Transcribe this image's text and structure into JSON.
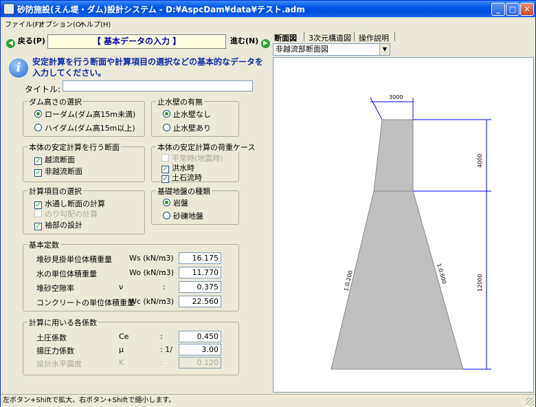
{
  "window": {
    "title": "砂防施設(えん堤・ダム)設計システム - D:¥AspcDam¥data¥テスト.adm",
    "controls": {
      "minimize": "_",
      "maximize": "□",
      "close": "✕"
    }
  },
  "menu": [
    "ファイル(F)",
    "オプション(O)",
    "ヘルプ(H)"
  ],
  "nav": {
    "back": "戻る(P)",
    "next": "進む(N)",
    "heading": "【 基本データの入力 】"
  },
  "info": "安定計算を行う断面や計算項目の選択などの基本的なデータを入力してください。",
  "title_field": {
    "label": "タイトル:",
    "value": ""
  },
  "dam_height": {
    "legend": "ダム高さの選択",
    "options": [
      "ローダム(ダム高15m未満)",
      "ハイダム(ダム高15m以上)"
    ],
    "selected": "ローダム(ダム高15m未満)"
  },
  "cutoff_wall": {
    "legend": "止水壁の有無",
    "options": [
      "止水壁なし",
      "止水壁あり"
    ],
    "selected": "止水壁なし"
  },
  "sections": {
    "legend": "本体の安定計算を行う断面",
    "items": [
      {
        "label": "越流断面",
        "checked": true
      },
      {
        "label": "非越流断面",
        "checked": true
      }
    ]
  },
  "load_cases": {
    "legend": "本体の安定計算の荷重ケース",
    "items": [
      {
        "label": "平常時(地震時)",
        "checked": false,
        "disabled": true
      },
      {
        "label": "洪水時",
        "checked": true,
        "disabled": false
      },
      {
        "label": "土石流時",
        "checked": true,
        "disabled": false
      }
    ]
  },
  "calc_items": {
    "legend": "計算項目の選択",
    "items": [
      {
        "label": "水通し断面の計算",
        "checked": true,
        "disabled": false
      },
      {
        "label": "のり勾配の計算",
        "checked": false,
        "disabled": true
      },
      {
        "label": "袖部の設計",
        "checked": true,
        "disabled": false
      }
    ]
  },
  "foundation": {
    "legend": "基礎地盤の種類",
    "options": [
      "岩盤",
      "砂礫地盤"
    ],
    "selected": "岩盤"
  },
  "constants": {
    "legend": "基本定数",
    "rows": [
      {
        "label": "堆砂見掛単位体積重量",
        "symbol": "Ws (kN/m3)",
        "colon": ":",
        "value": "16.175"
      },
      {
        "label": "水の単位体積重量",
        "symbol": "Wo (kN/m3)",
        "colon": ":",
        "value": "11.770"
      },
      {
        "label": "堆砂空隙率",
        "symbol": "ν",
        "colon": ":",
        "value": "0.375"
      },
      {
        "label": "コンクリートの単位体積重量",
        "symbol": "Wc (kN/m3)",
        "colon": ":",
        "value": "22.560"
      }
    ]
  },
  "coefficients": {
    "legend": "計算に用いる各係数",
    "rows": [
      {
        "label": "土圧係数",
        "symbol": "Ce",
        "colon": ":",
        "value": "0.450",
        "disabled": false
      },
      {
        "label": "揚圧力係数",
        "symbol": "μ",
        "colon": ": 1/",
        "value": "3.00",
        "disabled": false
      },
      {
        "label": "設計水平震度",
        "symbol": "K",
        "colon": ":",
        "value": "0.120",
        "disabled": true
      }
    ]
  },
  "right_tabs": [
    {
      "label": "断面図",
      "active": true
    },
    {
      "label": "3次元構造図",
      "active": false
    },
    {
      "label": "操作説明",
      "active": false
    }
  ],
  "view_select": "非越流部断面図",
  "drawing": {
    "crest_width": "3000",
    "upper_height": "4000",
    "lower_height": "12000",
    "upstream_slope": "1:0.200",
    "downstream_slope": "1:0.600",
    "fill_color": "#c0c0c0",
    "dim_color": "#0000ff"
  },
  "status": "左ボタン+Shiftで拡大、右ボタン+Shiftで縮小します。"
}
